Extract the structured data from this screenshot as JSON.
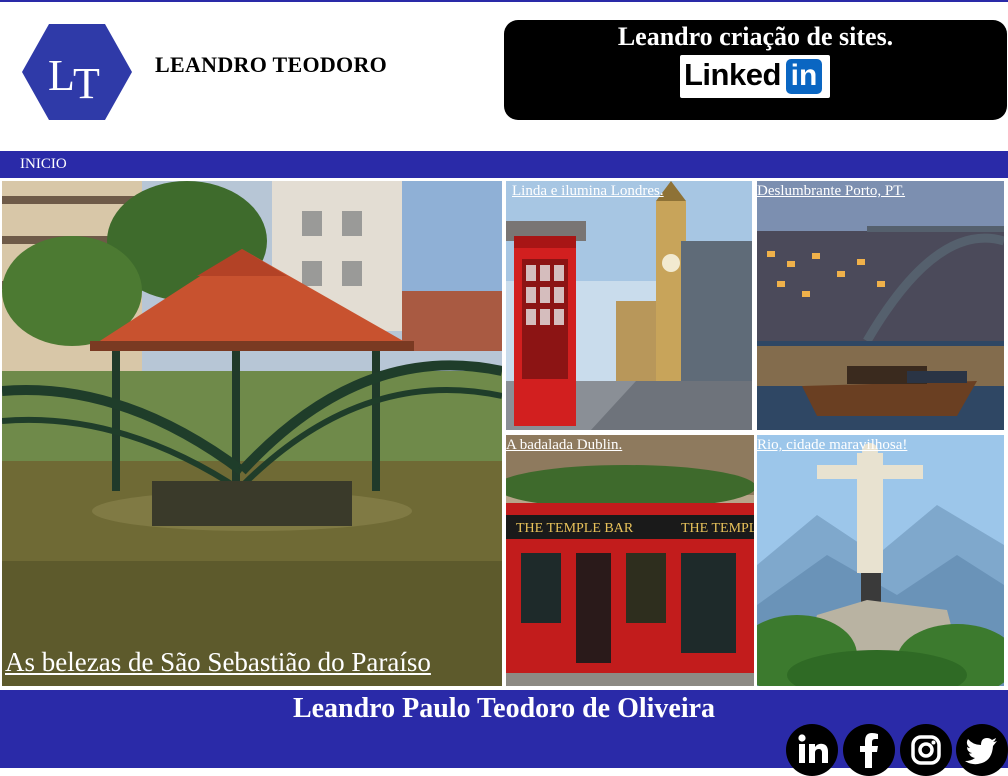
{
  "header": {
    "logo_letters": "LT",
    "brand": "LEANDRO TEODORO",
    "promo_title": "Leandro criação de sites.",
    "linkedin_word": "Linked",
    "linkedin_in": "in"
  },
  "nav": {
    "items": [
      "INICIO"
    ]
  },
  "gallery": {
    "main": {
      "caption": "As belezas de São Sebastião do Paraíso"
    },
    "tiles": [
      {
        "caption": "Linda e ilumina Londres."
      },
      {
        "caption": "Deslumbrante Porto, PT."
      },
      {
        "caption": "A badalada Dublin."
      },
      {
        "caption": "Rio, cidade maravilhosa!"
      }
    ]
  },
  "footer": {
    "name": "Leandro Paulo Teodoro de Oliveira",
    "social": [
      "linkedin-icon",
      "facebook-icon",
      "instagram-icon",
      "twitter-icon"
    ]
  },
  "colors": {
    "brand_blue": "#2a2aa8",
    "linkedin_blue": "#0a66c2",
    "black": "#000000"
  }
}
